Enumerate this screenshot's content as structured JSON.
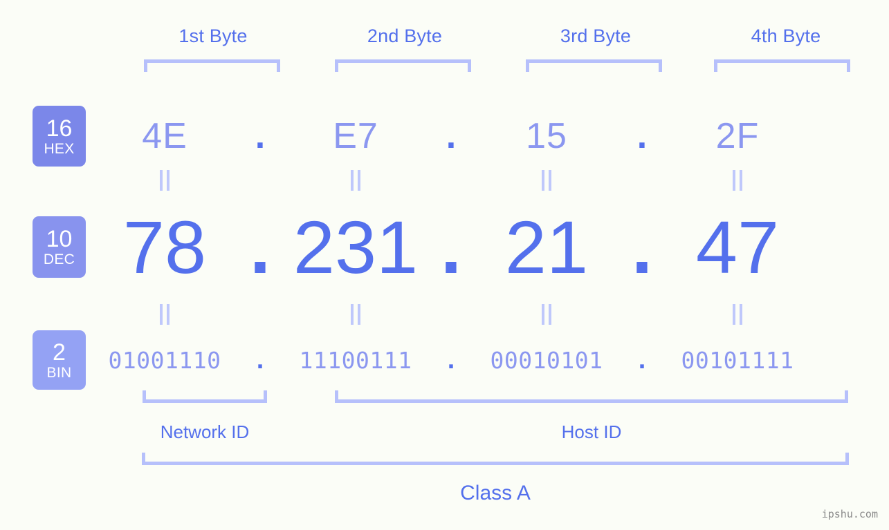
{
  "colors": {
    "background": "#fbfdf7",
    "accent_strong": "#5470ec",
    "accent_mid": "#8b97f0",
    "accent_light": "#b6c0fb",
    "badge_hex": "#7b87e9",
    "badge_dec": "#8893ee",
    "badge_bin": "#94a2f4",
    "watermark": "#8a8a8a"
  },
  "byte_headers": [
    {
      "label": "1st Byte"
    },
    {
      "label": "2nd Byte"
    },
    {
      "label": "3rd Byte"
    },
    {
      "label": "4th Byte"
    }
  ],
  "bases": [
    {
      "id": "hex",
      "number": "16",
      "abbr": "HEX"
    },
    {
      "id": "dec",
      "number": "10",
      "abbr": "DEC"
    },
    {
      "id": "bin",
      "number": "2",
      "abbr": "BIN"
    }
  ],
  "separator": ".",
  "rows": {
    "hex": {
      "values": [
        "4E",
        "E7",
        "15",
        "2F"
      ]
    },
    "dec": {
      "values": [
        "78",
        "231",
        "21",
        "47"
      ]
    },
    "bin": {
      "values": [
        "01001110",
        "11100111",
        "00010101",
        "00101111"
      ]
    }
  },
  "equals_mark": "||",
  "sections": [
    {
      "id": "network-id",
      "label": "Network ID"
    },
    {
      "id": "host-id",
      "label": "Host ID"
    }
  ],
  "class": {
    "label": "Class A"
  },
  "watermark": {
    "text": "ipshu.com"
  }
}
